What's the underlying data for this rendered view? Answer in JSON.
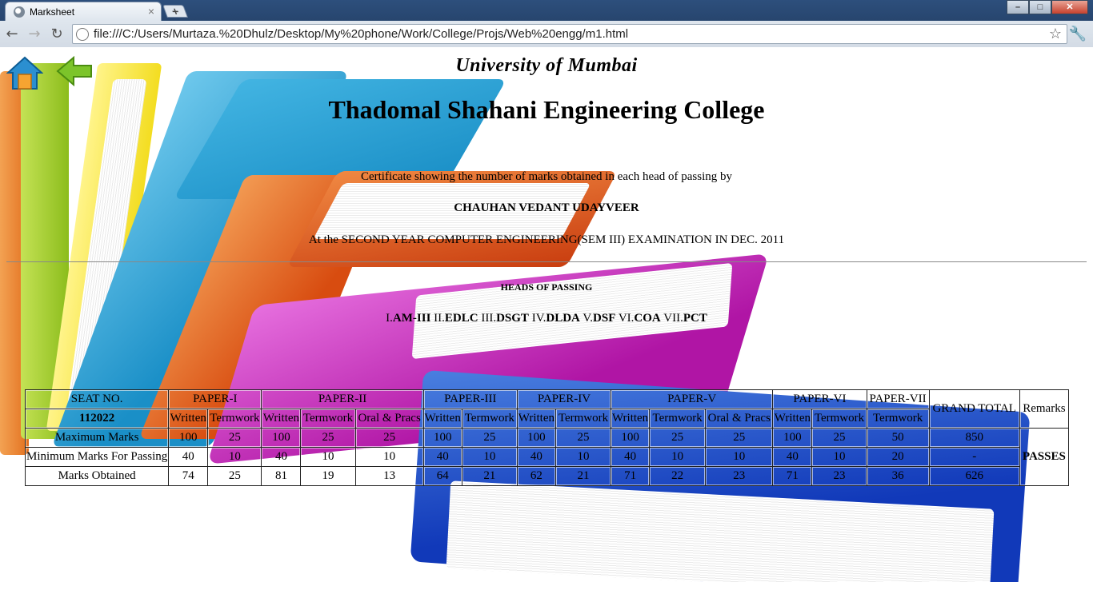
{
  "browser": {
    "tab_title": "Marksheet",
    "tab_close": "×",
    "new_tab": "+",
    "url": "file:///C:/Users/Murtaza.%20Dhulz/Desktop/My%20phone/Work/College/Projs/Web%20engg/m1.html",
    "back": "←",
    "forward": "→",
    "reload": "↻",
    "star": "☆",
    "wrench": "🔧",
    "win_min": "–",
    "win_max": "□",
    "win_close": "✕"
  },
  "page": {
    "university": "University of Mumbai",
    "college": "Thadomal Shahani Engineering College",
    "certificate_line": "Certificate showing the number of marks obtained in each head of passing by",
    "student_name": "CHAUHAN VEDANT UDAYVEER",
    "exam_line": "At the SECOND YEAR COMPUTER ENGINEERING(SEM III) EXAMINATION IN DEC. 2011",
    "heads_title": "HEADS OF PASSING",
    "heads": [
      {
        "num": "I.",
        "name": "AM-III"
      },
      {
        "num": "II.",
        "name": "EDLC"
      },
      {
        "num": "III.",
        "name": "DSGT"
      },
      {
        "num": "IV.",
        "name": "DLDA"
      },
      {
        "num": "V.",
        "name": "DSF"
      },
      {
        "num": "VI.",
        "name": "COA"
      },
      {
        "num": "VII.",
        "name": "PCT"
      }
    ]
  },
  "table": {
    "seat_label": "SEAT NO.",
    "seat_no": "112022",
    "papers": [
      "PAPER-I",
      "PAPER-II",
      "PAPER-III",
      "PAPER-IV",
      "PAPER-V",
      "PAPER-VI",
      "PAPER-VII"
    ],
    "grand_total": "GRAND TOTAL",
    "remarks": "Remarks",
    "sub_headers": [
      "Written",
      "Termwork",
      "Written",
      "Termwork",
      "Oral & Pracs",
      "Written",
      "Termwork",
      "Written",
      "Termwork",
      "Written",
      "Termwork",
      "Oral & Pracs",
      "Written",
      "Termwork",
      "Termwork"
    ],
    "rows": [
      {
        "label": "Maximum Marks",
        "values": [
          "100",
          "25",
          "100",
          "25",
          "25",
          "100",
          "25",
          "100",
          "25",
          "100",
          "25",
          "25",
          "100",
          "25",
          "50"
        ],
        "total": "850"
      },
      {
        "label": "Minimum Marks For Passing",
        "values": [
          "40",
          "10",
          "40",
          "10",
          "10",
          "40",
          "10",
          "40",
          "10",
          "40",
          "10",
          "10",
          "40",
          "10",
          "20"
        ],
        "total": "-"
      },
      {
        "label": "Marks Obtained",
        "values": [
          "74",
          "25",
          "81",
          "19",
          "13",
          "64",
          "21",
          "62",
          "21",
          "71",
          "22",
          "23",
          "71",
          "23",
          "36"
        ],
        "total": "626"
      }
    ],
    "result": "PASSES"
  }
}
